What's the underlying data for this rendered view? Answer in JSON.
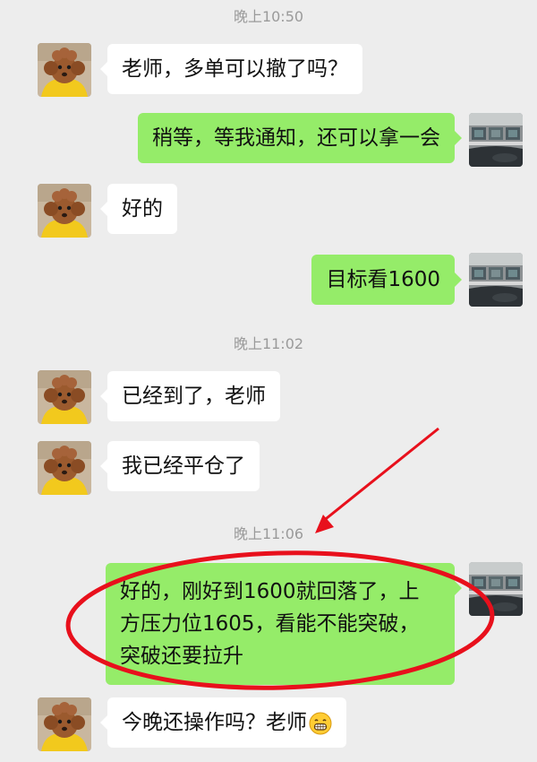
{
  "chat": {
    "timestamps": [
      "晚上10:50",
      "晚上11:02",
      "晚上11:06"
    ],
    "messages": [
      {
        "side": "received",
        "text": "老师，多单可以撤了吗？"
      },
      {
        "side": "sent",
        "text": "稍等，等我通知，还可以拿一会"
      },
      {
        "side": "received",
        "text": "好的"
      },
      {
        "side": "sent",
        "text": "目标看1600"
      },
      {
        "side": "received",
        "text": "已经到了，老师"
      },
      {
        "side": "received",
        "text": "我已经平仓了"
      },
      {
        "side": "sent",
        "lines": [
          "好的，刚好到1600就回落了，上",
          "方压力位1605，看能不能突破，",
          "突破还要拉升"
        ]
      },
      {
        "side": "received",
        "text": "今晚还操作吗？老师",
        "emoji": "grinning-face-emoji"
      }
    ]
  },
  "annotation": {
    "color": "#e8101c",
    "shapes": [
      "red-ellipse",
      "red-arrow"
    ]
  },
  "colors": {
    "background": "#ededed",
    "sent_bubble": "#95ec69",
    "received_bubble": "#ffffff",
    "timestamp": "#9a9a9a"
  }
}
